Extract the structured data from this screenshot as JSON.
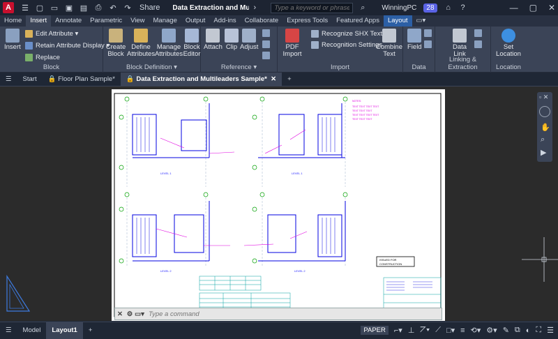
{
  "titlebar": {
    "app_logo": "A",
    "share": "Share",
    "doc_title": "Data Extraction and Multi...",
    "search_placeholder": "Type a keyword or phrase",
    "user": "WinningPC",
    "badge": "28"
  },
  "ribbon_tabs": [
    "Home",
    "Insert",
    "Annotate",
    "Parametric",
    "View",
    "Manage",
    "Output",
    "Add-ins",
    "Collaborate",
    "Express Tools",
    "Featured Apps",
    "Layout"
  ],
  "ribbon": {
    "block": {
      "title": "Block",
      "insert": "Insert",
      "edit_attribute": "Edit Attribute",
      "retain_attr": "Retain Attribute Display",
      "replace": "Replace"
    },
    "block_definition": {
      "title": "Block Definition",
      "create": "Create\nBlock",
      "define": "Define\nAttributes",
      "manage": "Manage\nAttributes",
      "editor": "Block\nEditor"
    },
    "reference": {
      "title": "Reference",
      "attach": "Attach",
      "clip": "Clip",
      "adjust": "Adjust"
    },
    "import": {
      "title": "Import",
      "pdf": "PDF\nImport",
      "shx": "Recognize SHX Text",
      "settings": "Recognition Settings",
      "combine": "Combine\nText"
    },
    "data": {
      "title": "Data",
      "field": "Field"
    },
    "linking": {
      "title": "Linking & Extraction",
      "data_link": "Data\nLink"
    },
    "location": {
      "title": "Location",
      "set": "Set\nLocation"
    }
  },
  "file_tabs": [
    "Start",
    "Floor Plan Sample*",
    "Data Extraction and Multileaders Sample*"
  ],
  "command": {
    "placeholder": "Type a command"
  },
  "status": {
    "tabs": [
      "Model",
      "Layout1"
    ],
    "paper": "PAPER"
  },
  "drawing": {
    "title_block": "ISSUED FOR\nCONSTRUCTION",
    "level_labels": [
      "LEVEL 1",
      "LEVEL 1",
      "LEVEL 2",
      "LEVEL 2"
    ]
  }
}
